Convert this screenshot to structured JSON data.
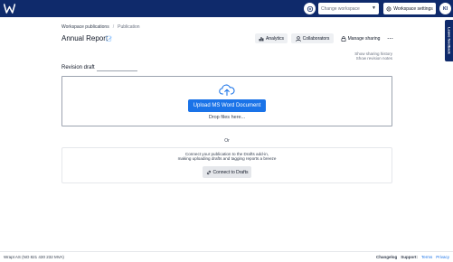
{
  "header": {
    "workspace_select_placeholder": "Change workspace",
    "workspace_settings_label": "Workspace settings",
    "avatar_initials": "KI",
    "side_tab_label": "Leave feedback"
  },
  "breadcrumb": {
    "parent": "Workspace publications",
    "current": "Publication"
  },
  "page": {
    "title": "Annual Report"
  },
  "actions": {
    "analytics": "Analytics",
    "collaborators": "Collaborators",
    "manage_sharing": "Manage sharing",
    "more": "⋯"
  },
  "side_links": {
    "sharing_history": "Show sharing history",
    "revision_notes": "Show revision notes"
  },
  "revision": {
    "title": "Revision draft"
  },
  "upload": {
    "button_label": "Upload MS Word Document",
    "drop_text": "Drop files here..."
  },
  "divider_text": "Or",
  "connect": {
    "line1": "Connect your publication to the Drafts add-in,",
    "line2": "making uploading drafts and tagging reports a breeze",
    "button_label": "Connect to Drafts"
  },
  "footer": {
    "company": "Wrapt AS (NO 821 430 232 MVA)",
    "changelog": "Changelog",
    "support_label": "Support:",
    "terms": "Terms",
    "privacy": "Privacy"
  },
  "colors": {
    "topbar": "#0f2a6b",
    "accent": "#1a73e8"
  }
}
